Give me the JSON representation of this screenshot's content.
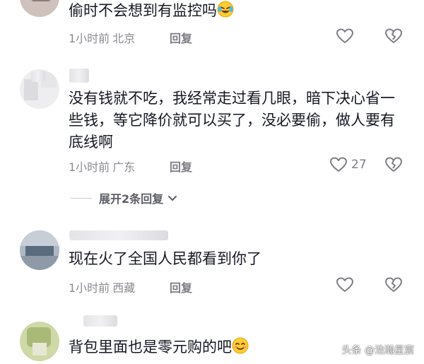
{
  "comments": [
    {
      "text": "偷时不会想到有监控吗",
      "time": "1小时前",
      "location": "北京",
      "reply_label": "回复",
      "likes": "",
      "emoji": "laughing-crying-emoji"
    },
    {
      "text": "没有钱就不吃，我经常走过看几眼，暗下决心省一些钱，等它降价就可以买了，没必要偷，做人要有底线啊",
      "time": "1小时前",
      "location": "广东",
      "reply_label": "回复",
      "likes": "27"
    },
    {
      "text": "现在火了全国人民都看到你了",
      "time": "1小时前",
      "location": "西藏",
      "reply_label": "回复",
      "likes": ""
    },
    {
      "text": "背包里面也是零元购的吧",
      "emoji": "smiling-blush-emoji"
    }
  ],
  "expand_replies": "展开2条回复",
  "watermark": "头条 @浩瀚星宸",
  "colors": {
    "text": "#161823",
    "meta": "#8a8b91",
    "icon": "#7d7e84"
  }
}
